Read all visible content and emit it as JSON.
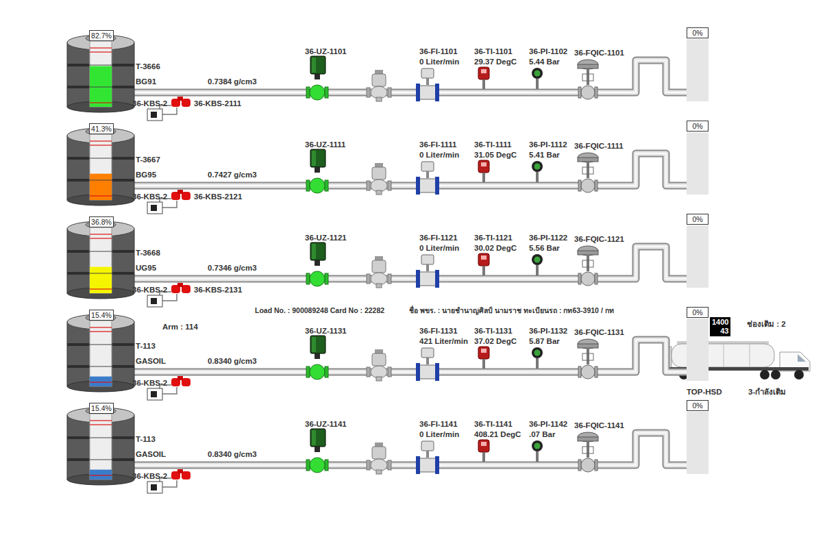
{
  "lanes": [
    {
      "tank": {
        "percent": "82.7%",
        "level": 0.62,
        "color": "#33e533",
        "name": "T-3666",
        "product": "BG91",
        "density": "0.7384 g/cm3"
      },
      "switch_tags": [
        "36-KBS-2",
        "36-KBS-2111"
      ],
      "valve": "36-UZ-1101",
      "flow": {
        "tag": "36-FI-1101",
        "reading": "0 Liter/min"
      },
      "temperature": {
        "tag": "36-TI-1101",
        "reading": "29.37 DegC"
      },
      "pressure": {
        "tag": "36-PI-1102",
        "reading": "5.44 Bar"
      },
      "control_valve": "36-FQIC-1101",
      "bay": {
        "percent": "0%",
        "level": 0
      }
    },
    {
      "tank": {
        "percent": "41.3%",
        "level": 0.4,
        "color": "#ff7f00",
        "name": "T-3667",
        "product": "BG95",
        "density": "0.7427 g/cm3"
      },
      "switch_tags": [
        "36-KBS-2",
        "36-KBS-2121"
      ],
      "valve": "36-UZ-1111",
      "flow": {
        "tag": "36-FI-1111",
        "reading": "0 Liter/min"
      },
      "temperature": {
        "tag": "36-TI-1111",
        "reading": "31.05 DegC"
      },
      "pressure": {
        "tag": "36-PI-1112",
        "reading": "5.41 Bar"
      },
      "control_valve": "36-FQIC-1111",
      "bay": {
        "percent": "0%",
        "level": 0
      }
    },
    {
      "tank": {
        "percent": "36.8%",
        "level": 0.4,
        "color": "#f5f500",
        "name": "T-3668",
        "product": "UG95",
        "density": "0.7346 g/cm3"
      },
      "switch_tags": [
        "36-KBS-2",
        "36-KBS-2131"
      ],
      "valve": "36-UZ-1121",
      "flow": {
        "tag": "36-FI-1121",
        "reading": "0 Liter/min"
      },
      "temperature": {
        "tag": "36-TI-1121",
        "reading": "30.02 DegC"
      },
      "pressure": {
        "tag": "36-PI-1122",
        "reading": "5.56 Bar"
      },
      "control_valve": "36-FQIC-1121",
      "bay": {
        "percent": "0%",
        "level": 0
      }
    },
    {
      "tank": {
        "percent": "15.4%",
        "level": 0.15,
        "color": "#3a7cc9",
        "name": "T-113",
        "product": "GASOIL",
        "density": "0.8340 g/cm3"
      },
      "switch_tags": [
        "36-KBS-2"
      ],
      "valve": "36-UZ-1131",
      "flow": {
        "tag": "36-FI-1131",
        "reading": "421 Liter/min"
      },
      "temperature": {
        "tag": "36-TI-1131",
        "reading": "37.02 DegC"
      },
      "pressure": {
        "tag": "36-PI-1132",
        "reading": "5.87 Bar"
      },
      "control_valve": "36-FQIC-1131",
      "bay": {
        "percent": "0%",
        "level": 0
      },
      "arm": "Arm : 114",
      "loading": {
        "info": "Load No. : 900089248 Card No : 22282",
        "driver": "ชื่อ พขร. : นายชำนาญศิลป์ นามราช ทะเบียนรถ : กท63-3910 / กท",
        "counter": [
          "1400",
          "43"
        ],
        "compartment": "ช่องเติม : 2",
        "product_code": "TOP-HSD",
        "status": "3-กำลังเติม"
      }
    },
    {
      "tank": {
        "percent": "15.4%",
        "level": 0.15,
        "color": "#3a7cc9",
        "name": "T-113",
        "product": "GASOIL",
        "density": "0.8340 g/cm3"
      },
      "switch_tags": [
        "36-KBS-2"
      ],
      "valve": "36-UZ-1141",
      "flow": {
        "tag": "36-FI-1141",
        "reading": "0 Liter/min"
      },
      "temperature": {
        "tag": "36-TI-1141",
        "reading": "408.21 DegC"
      },
      "pressure": {
        "tag": "36-PI-1142",
        "reading": ".07 Bar"
      },
      "control_valve": "36-FQIC-1141",
      "bay": {
        "percent": "0%",
        "level": 0
      }
    }
  ]
}
